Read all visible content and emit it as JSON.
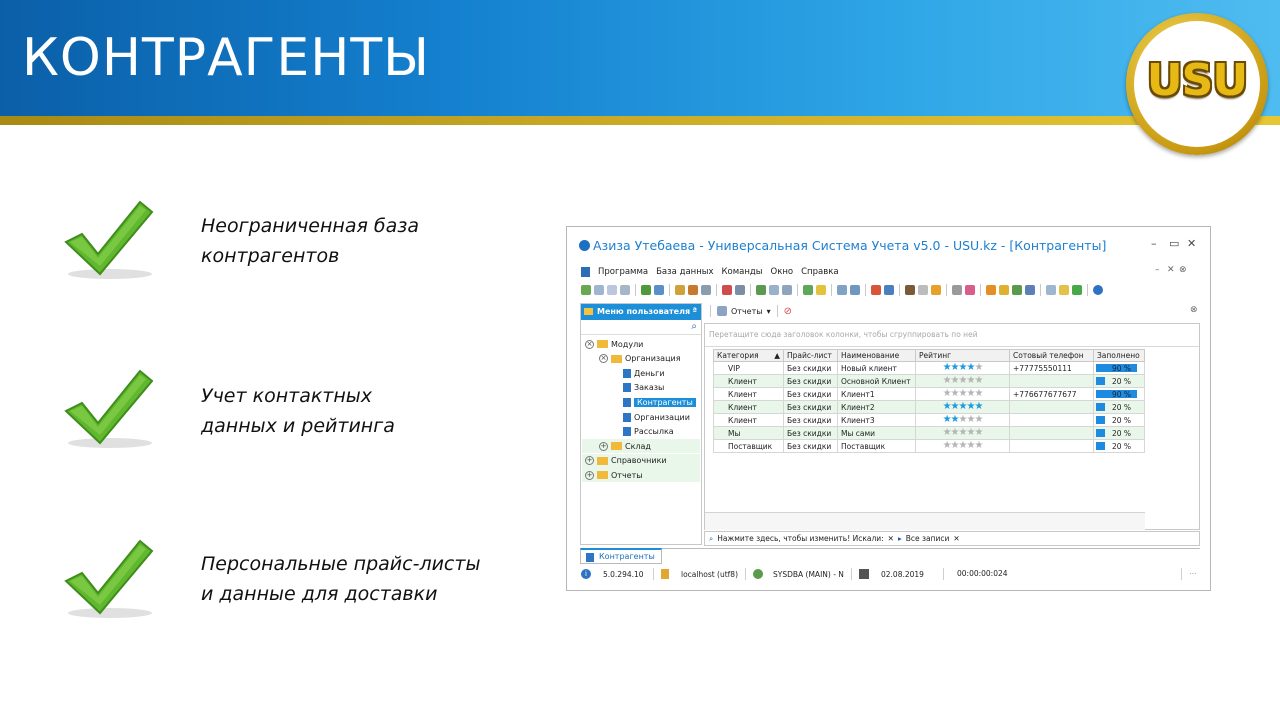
{
  "slide": {
    "title": "КОНТРАГЕНТЫ",
    "logo_text": "USU",
    "colors": {
      "banner": "#1480cf",
      "gold": "#d2b12a",
      "check": "#5fb82e"
    }
  },
  "features": [
    {
      "line1": "Неограниченная  база",
      "line2": "контрагентов"
    },
    {
      "line1": "Учет контактных",
      "line2": "данных и рейтинга"
    },
    {
      "line1": "Персональные прайс-листы",
      "line2": "и данные для доставки"
    }
  ],
  "app": {
    "title": "Азиза Утебаева - Универсальная Система Учета v5.0 - USU.kz - [Контрагенты]",
    "window_controls": [
      "–",
      "▭",
      "✕"
    ],
    "menu": [
      "Программа",
      "База данных",
      "Команды",
      "Окно",
      "Справка"
    ],
    "mdi_controls": [
      "–",
      "✕",
      "⊗"
    ],
    "sidebar": {
      "header": "Меню пользователя",
      "pin": "ª",
      "tree": [
        {
          "label": "Модули",
          "level": 0,
          "type": "folder",
          "exp": "⊗"
        },
        {
          "label": "Организация",
          "level": 1,
          "type": "folder",
          "exp": "⊗"
        },
        {
          "label": "Деньги",
          "level": 2,
          "type": "doc"
        },
        {
          "label": "Заказы",
          "level": 2,
          "type": "doc"
        },
        {
          "label": "Контрагенты",
          "level": 2,
          "type": "doc",
          "selected": true
        },
        {
          "label": "Организации",
          "level": 2,
          "type": "doc"
        },
        {
          "label": "Рассылка",
          "level": 2,
          "type": "doc"
        },
        {
          "label": "Склад",
          "level": 1,
          "type": "folder",
          "exp": "+"
        },
        {
          "label": "Справочники",
          "level": 0,
          "type": "folder",
          "exp": "+"
        },
        {
          "label": "Отчеты",
          "level": 0,
          "type": "folder",
          "exp": "+"
        }
      ]
    },
    "reports_label": "Отчеты",
    "group_hint": "Перетащите сюда заголовок колонки, чтобы сгруппировать по ней",
    "grid": {
      "columns": [
        "Категория",
        "Прайс-лист",
        "Наименование",
        "Рейтинг",
        "Сотовый телефон",
        "Заполнено"
      ],
      "rows": [
        {
          "category": "VIP",
          "price": "Без скидки",
          "name": "Новый клиент",
          "rating": 4,
          "phone": "+77775550111",
          "filled": 90,
          "filled_text": "90 %"
        },
        {
          "category": "Клиент",
          "price": "Без скидки",
          "name": "Основной Клиент",
          "rating": 0,
          "phone": "",
          "filled": 20,
          "filled_text": "20 %"
        },
        {
          "category": "Клиент",
          "price": "Без скидки",
          "name": "Клиент1",
          "rating": 0,
          "phone": "+776677677677",
          "filled": 90,
          "filled_text": "90 %"
        },
        {
          "category": "Клиент",
          "price": "Без скидки",
          "name": "Клиент2",
          "rating": 5,
          "phone": "",
          "filled": 20,
          "filled_text": "20 %"
        },
        {
          "category": "Клиент",
          "price": "Без скидки",
          "name": "Клиент3",
          "rating": 2,
          "phone": "",
          "filled": 20,
          "filled_text": "20 %"
        },
        {
          "category": "Мы",
          "price": "Без скидки",
          "name": "Мы сами",
          "rating": 0,
          "phone": "",
          "filled": 20,
          "filled_text": "20 %"
        },
        {
          "category": "Поставщик",
          "price": "Без скидки",
          "name": "Поставщик",
          "rating": 0,
          "phone": "",
          "filled": 20,
          "filled_text": "20 %"
        }
      ]
    },
    "filter_bar": {
      "hint": "Нажмите здесь, чтобы изменить! Искали:",
      "all_records": "Все записи"
    },
    "tab_label": "Контрагенты",
    "status": {
      "version": "5.0.294.10",
      "server": "localhost (utf8)",
      "user": "SYSDBA (MAIN) - N",
      "date": "02.08.2019",
      "timer": "00:00:00:024"
    }
  }
}
